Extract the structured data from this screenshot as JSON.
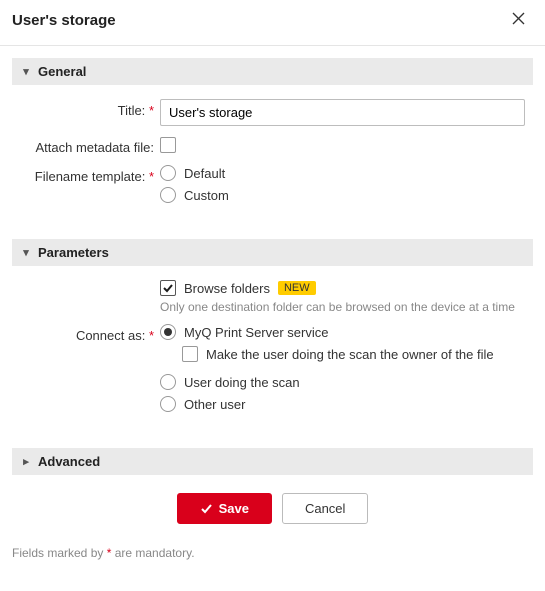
{
  "header": {
    "title": "User's storage"
  },
  "sections": {
    "general": {
      "label": "General",
      "expanded": true
    },
    "parameters": {
      "label": "Parameters",
      "expanded": true
    },
    "advanced": {
      "label": "Advanced",
      "expanded": false
    }
  },
  "general": {
    "title_label": "Title:",
    "title_value": "User's storage",
    "attach_metadata_label": "Attach metadata file:",
    "attach_metadata_checked": false,
    "filename_template_label": "Filename template:",
    "filename_options": {
      "default": "Default",
      "custom": "Custom",
      "selected": ""
    }
  },
  "parameters": {
    "browse_folders_label": "Browse folders",
    "browse_folders_checked": true,
    "new_badge": "NEW",
    "browse_hint": "Only one destination folder can be browsed on the device at a time",
    "connect_as_label": "Connect as:",
    "connect_options": {
      "service": "MyQ Print Server service",
      "user_scan": "User doing the scan",
      "other_user": "Other user",
      "selected": "service"
    },
    "make_owner_label": "Make the user doing the scan the owner of the file",
    "make_owner_checked": false
  },
  "buttons": {
    "save": "Save",
    "cancel": "Cancel"
  },
  "mandatory_note": {
    "prefix": "Fields marked by ",
    "suffix": " are mandatory."
  }
}
